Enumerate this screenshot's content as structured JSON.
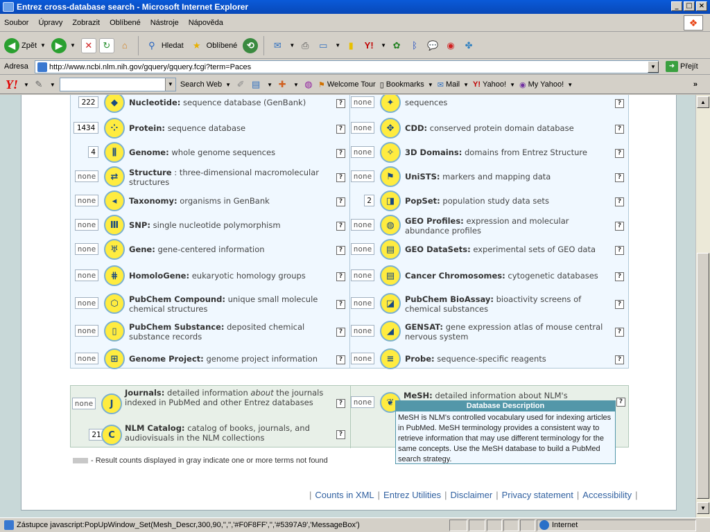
{
  "window": {
    "title": "Entrez cross-database search - Microsoft Internet Explorer"
  },
  "menu": {
    "items": [
      "Soubor",
      "Úpravy",
      "Zobrazit",
      "Oblíbené",
      "Nástroje",
      "Nápověda"
    ]
  },
  "toolbar": {
    "back_label": "Zpět",
    "search_label": "Hledat",
    "favorites_label": "Oblíbené"
  },
  "address": {
    "label": "Adresa",
    "url": "http://www.ncbi.nlm.nih.gov/gquery/gquery.fcgi?term=Paces",
    "go_label": "Přejít"
  },
  "yahoo": {
    "search_web": "Search Web",
    "welcome_tour": "Welcome Tour",
    "bookmarks": "Bookmarks",
    "mail": "Mail",
    "yahoo": "Yahoo!",
    "my_yahoo": "My Yahoo!",
    "more": "»"
  },
  "databases_left": [
    {
      "count": "222",
      "name": "Nucleotide:",
      "desc": "sequence database (GenBank)"
    },
    {
      "count": "1434",
      "name": "Protein:",
      "desc": "sequence database"
    },
    {
      "count": "4",
      "name": "Genome:",
      "desc": "whole genome sequences"
    },
    {
      "count": "none",
      "name": "Structure",
      "desc": ": three-dimensional macromolecular structures"
    },
    {
      "count": "none",
      "name": "Taxonomy:",
      "desc": "organisms in GenBank"
    },
    {
      "count": "none",
      "name": "SNP:",
      "desc": "single nucleotide polymorphism"
    },
    {
      "count": "none",
      "name": "Gene:",
      "desc": "gene-centered information"
    },
    {
      "count": "none",
      "name": "HomoloGene:",
      "desc": "eukaryotic homology groups"
    },
    {
      "count": "none",
      "name": "PubChem Compound:",
      "desc": "unique small molecule chemical structures"
    },
    {
      "count": "none",
      "name": "PubChem Substance:",
      "desc": "deposited chemical substance records"
    },
    {
      "count": "none",
      "name": "Genome Project:",
      "desc": "genome project information"
    }
  ],
  "databases_right": [
    {
      "count": "none",
      "name": "",
      "desc": "sequences"
    },
    {
      "count": "none",
      "name": "CDD:",
      "desc": "conserved protein domain database"
    },
    {
      "count": "none",
      "name": "3D Domains:",
      "desc": "domains from Entrez Structure"
    },
    {
      "count": "none",
      "name": "UniSTS:",
      "desc": "markers and mapping data"
    },
    {
      "count": "2",
      "name": "PopSet:",
      "desc": "population study data sets"
    },
    {
      "count": "none",
      "name": "GEO Profiles:",
      "desc": "expression and molecular abundance profiles"
    },
    {
      "count": "none",
      "name": "GEO DataSets:",
      "desc": "experimental sets of GEO data"
    },
    {
      "count": "none",
      "name": "Cancer Chromosomes:",
      "desc": "cytogenetic databases"
    },
    {
      "count": "none",
      "name": "PubChem BioAssay:",
      "desc": "bioactivity screens of chemical substances"
    },
    {
      "count": "none",
      "name": "GENSAT:",
      "desc": "gene expression atlas of mouse central nervous system"
    },
    {
      "count": "none",
      "name": "Probe:",
      "desc": "sequence-specific reagents"
    }
  ],
  "bottom": {
    "journals": {
      "count": "none",
      "name": "Journals:",
      "desc_a": "detailed information",
      "desc_em": "about",
      "desc_b": "the journals indexed in PubMed and other Entrez databases"
    },
    "nlm": {
      "count": "21",
      "name": "NLM Catalog:",
      "desc": "catalog of books, journals, and audiovisuals in the NLM collections"
    },
    "mesh": {
      "count": "none",
      "name": "MeSH:",
      "desc": "detailed information about NLM's"
    }
  },
  "legend": "- Result counts displayed in gray indicate one or more terms not found",
  "footer": [
    "Counts in XML",
    "Entrez Utilities",
    "Disclaimer",
    "Privacy statement",
    "Accessibility"
  ],
  "tooltip": {
    "title": "Database Description",
    "body": "MeSH is NLM's controlled vocabulary used for indexing articles in PubMed. MeSH terminology provides a consistent way to retrieve information that may use different terminology for the same concepts. Use the MeSH database to build a PubMed search strategy."
  },
  "status": {
    "text": "Zástupce javascript:PopUpWindow_Set(Mesh_Descr,300,90,'','','#F0F8FF','','#5397A9','MessageBox')",
    "zone": "Internet"
  },
  "colors": {
    "tooltip_header": "#5397A9",
    "tooltip_bg": "#F0F8FF"
  },
  "help_glyph": "?"
}
